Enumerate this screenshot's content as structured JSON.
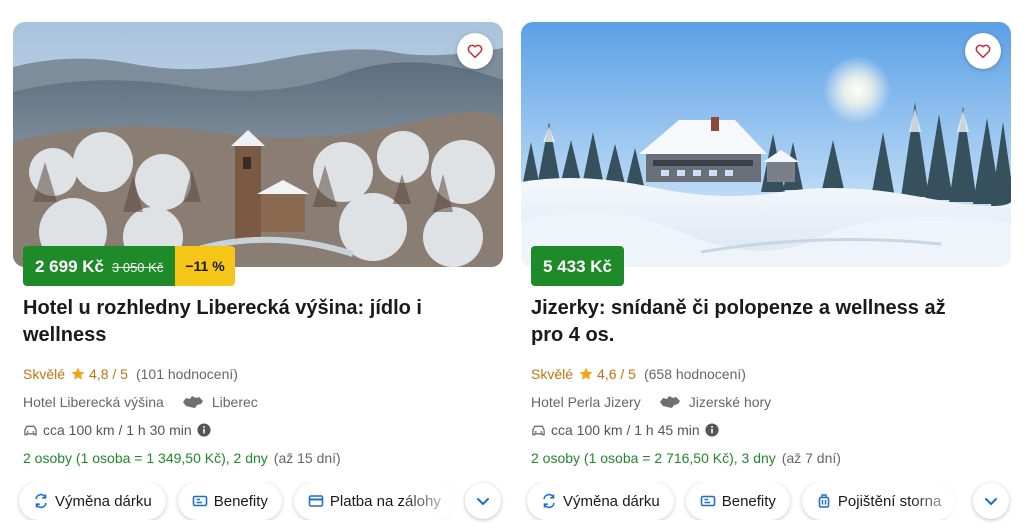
{
  "cards": [
    {
      "price_now": "2 699 Kč",
      "price_old": "3 050 Kč",
      "discount": "−11 %",
      "title": "Hotel u rozhledny Liberecká výšina: jídlo i wellness",
      "rating_label": "Skvělé",
      "rating_score": "4,8 / 5",
      "rating_count": "(101 hodnocení)",
      "hotel_name": "Hotel Liberecká výšina",
      "region": "Liberec",
      "distance": "cca 100 km / 1 h 30 min",
      "persons": "2 osoby (1 osoba = 1 349,50 Kč), 2 dny",
      "availability": "(až 15 dní)",
      "chips": [
        "Výměna dárku",
        "Benefity",
        "Platba na zálohy"
      ]
    },
    {
      "price_now": "5 433 Kč",
      "title": "Jizerky: snídaně či polopenze a wellness až pro 4 os.",
      "rating_label": "Skvělé",
      "rating_score": "4,6 / 5",
      "rating_count": "(658 hodnocení)",
      "hotel_name": "Hotel Perla Jizery",
      "region": "Jizerské hory",
      "distance": "cca 100 km / 1 h 45 min",
      "persons": "2 osoby (1 osoba = 2 716,50 Kč), 3 dny",
      "availability": "(až 7 dní)",
      "chips": [
        "Výměna dárku",
        "Benefity",
        "Pojištění storna"
      ]
    }
  ],
  "icons": {
    "favorite": "heart-outline-icon",
    "rating": "star-icon",
    "region": "czech-map-icon",
    "distance": "car-icon",
    "info": "info-icon",
    "chip_exchange": "exchange-icon",
    "chip_benefits": "ticket-icon",
    "chip_payment": "card-icon",
    "chip_insurance": "luggage-icon",
    "more": "chevron-down-icon"
  },
  "colors": {
    "price_bg": "#1f8a2a",
    "discount_bg": "#f5c518",
    "rating": "#c7720e",
    "persons": "#1f8a2a",
    "accent": "#1a6fd1",
    "heart": "#c62e3a"
  }
}
